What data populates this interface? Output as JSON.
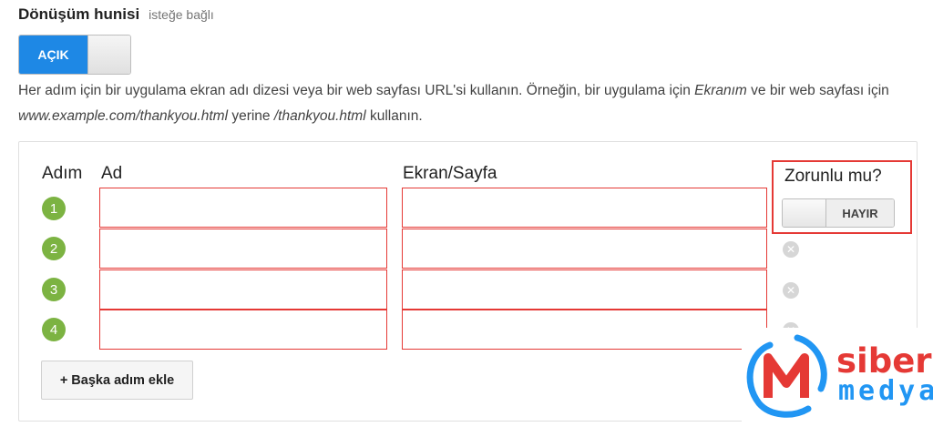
{
  "header": {
    "title": "Dönüşüm hunisi",
    "optional_label": "isteğe bağlı"
  },
  "funnel_toggle": {
    "state_label": "AÇIK",
    "on": true
  },
  "help": {
    "part1": "Her adım için bir uygulama ekran adı dizesi veya bir web sayfası URL'si kullanın. Örneğin, bir uygulama için ",
    "example_app": "Ekranım",
    "part2": " ve bir web sayfası için ",
    "example_url": "www.example.com/thankyou.html",
    "part3": " yerine ",
    "example_path": "/thankyou.html",
    "part4": " kullanın."
  },
  "table": {
    "columns": {
      "step": "Adım",
      "name": "Ad",
      "screen": "Ekran/Sayfa",
      "required": "Zorunlu mu?"
    },
    "rows": [
      {
        "step": "1",
        "name": "",
        "screen": "",
        "removable": false
      },
      {
        "step": "2",
        "name": "",
        "screen": "",
        "removable": true
      },
      {
        "step": "3",
        "name": "",
        "screen": "",
        "removable": true
      },
      {
        "step": "4",
        "name": "",
        "screen": "",
        "removable": true
      }
    ],
    "required_toggle": {
      "state_label": "HAYIR",
      "on": false
    }
  },
  "add_step_button": {
    "label": "+ Başka adım ekle"
  },
  "watermark": {
    "line1": "siber",
    "line2": "medya"
  },
  "colors": {
    "accent_blue": "#1e88e5",
    "step_green": "#7cb342",
    "highlight_red": "#e53935"
  }
}
